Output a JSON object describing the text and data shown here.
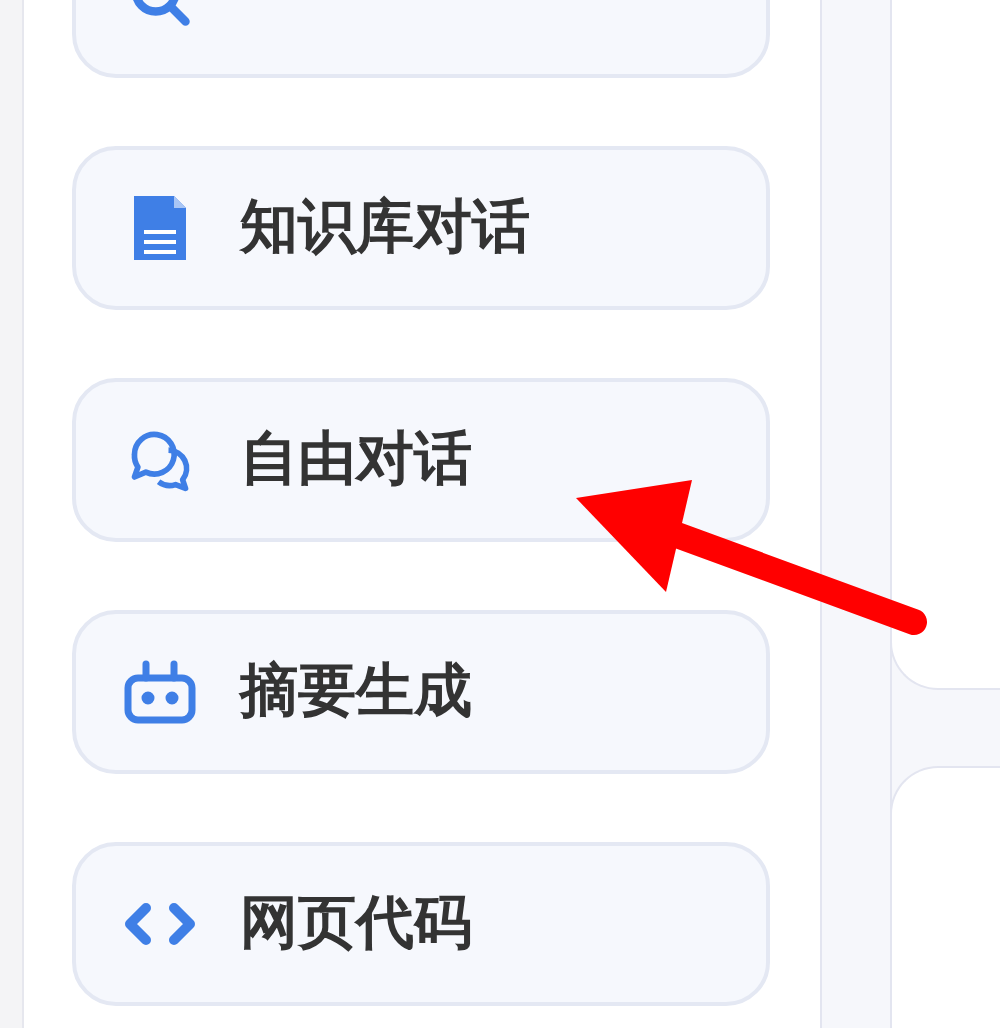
{
  "sidebar": {
    "items": [
      {
        "label": "知识库对话"
      },
      {
        "label": "自由对话"
      },
      {
        "label": "摘要生成"
      },
      {
        "label": "网页代码"
      }
    ]
  }
}
